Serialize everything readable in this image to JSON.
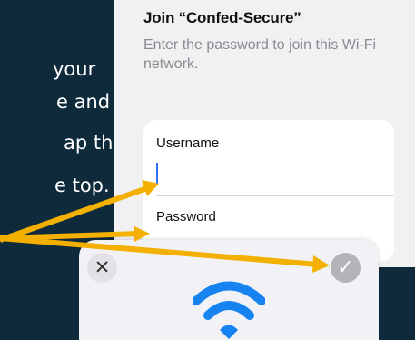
{
  "instructions": {
    "line1": "your",
    "line2": "e and",
    "line3": "ap the",
    "line4": "e top."
  },
  "wifi_sheet": {
    "title": "Join “Confed-Secure”",
    "subtitle": "Enter the password to join this Wi-Fi network."
  },
  "form": {
    "username_label": "Username",
    "username_value": "",
    "password_label": "Password"
  },
  "popup": {
    "close_icon": "close-icon",
    "confirm_icon": "checkmark-icon",
    "wifi_icon": "wifi-icon"
  },
  "colors": {
    "background": "#0e2a3b",
    "arrow": "#f3b000",
    "caret": "#2f6ff0",
    "wifi": "#1783f0"
  }
}
